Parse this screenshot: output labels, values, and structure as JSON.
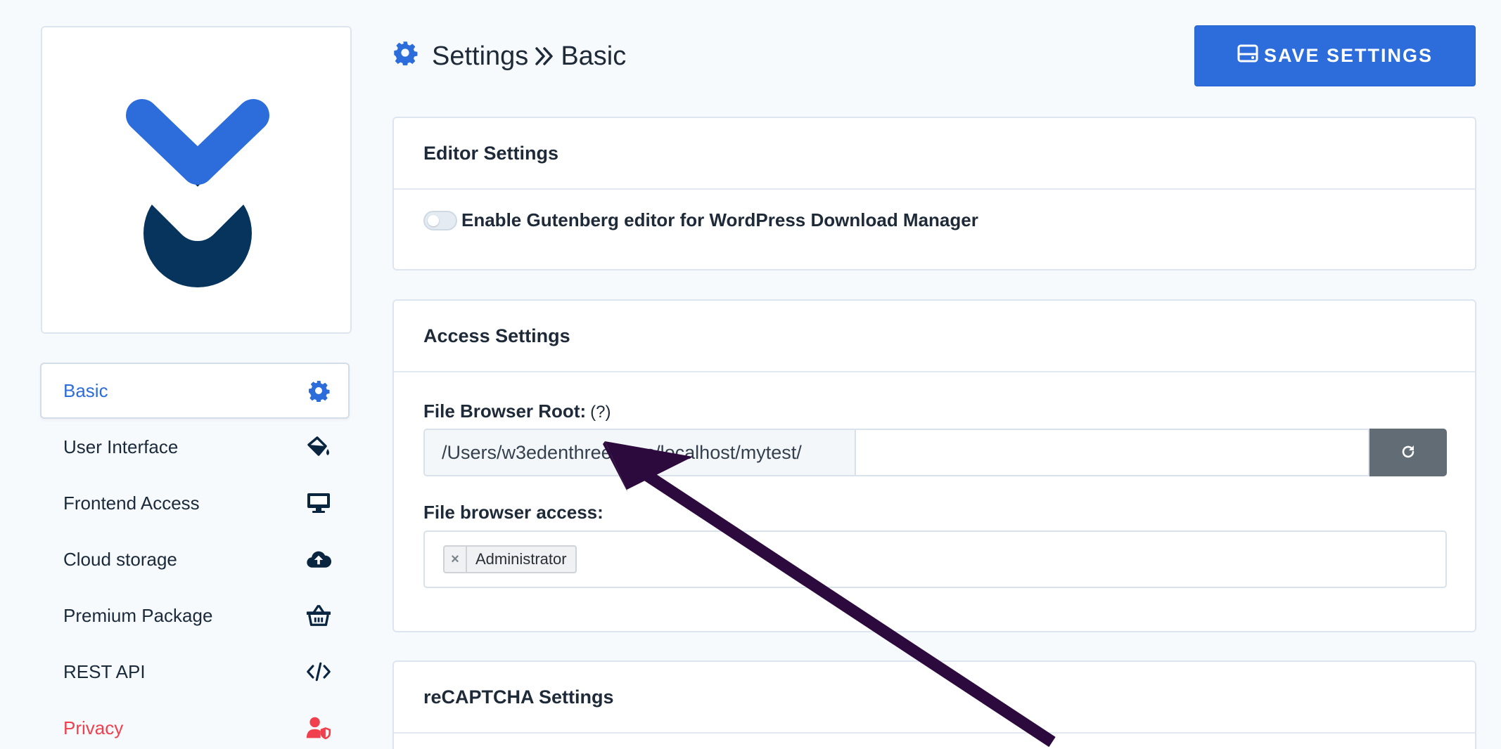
{
  "header": {
    "title": "Settings",
    "subtitle": "Basic",
    "save_label": "SAVE SETTINGS"
  },
  "sidebar": {
    "items": [
      {
        "label": "Basic",
        "icon": "gear-icon",
        "active": true
      },
      {
        "label": "User Interface",
        "icon": "paint-bucket-icon"
      },
      {
        "label": "Frontend Access",
        "icon": "monitor-icon"
      },
      {
        "label": "Cloud storage",
        "icon": "cloud-upload-icon"
      },
      {
        "label": "Premium Package",
        "icon": "basket-icon"
      },
      {
        "label": "REST API",
        "icon": "code-icon"
      },
      {
        "label": "Privacy",
        "icon": "user-shield-icon",
        "color": "#f0404e"
      }
    ]
  },
  "editor_settings": {
    "title": "Editor Settings",
    "gutenberg_label": "Enable Gutenberg editor for WordPress Download Manager",
    "gutenberg_enabled": false
  },
  "access_settings": {
    "title": "Access Settings",
    "root_label": "File Browser Root:",
    "root_hint": "(?)",
    "root_prefix": "/Users/w3edenthreesixes/localhost/mytest/",
    "root_value": "",
    "access_label": "File browser access:",
    "access_tags": [
      "Administrator"
    ]
  },
  "recaptcha_settings": {
    "title": "reCAPTCHA Settings"
  },
  "colors": {
    "accent": "#2c6ddb",
    "danger": "#f0404e",
    "logo_dark": "#07345c",
    "arrow": "#2d0a3e"
  }
}
